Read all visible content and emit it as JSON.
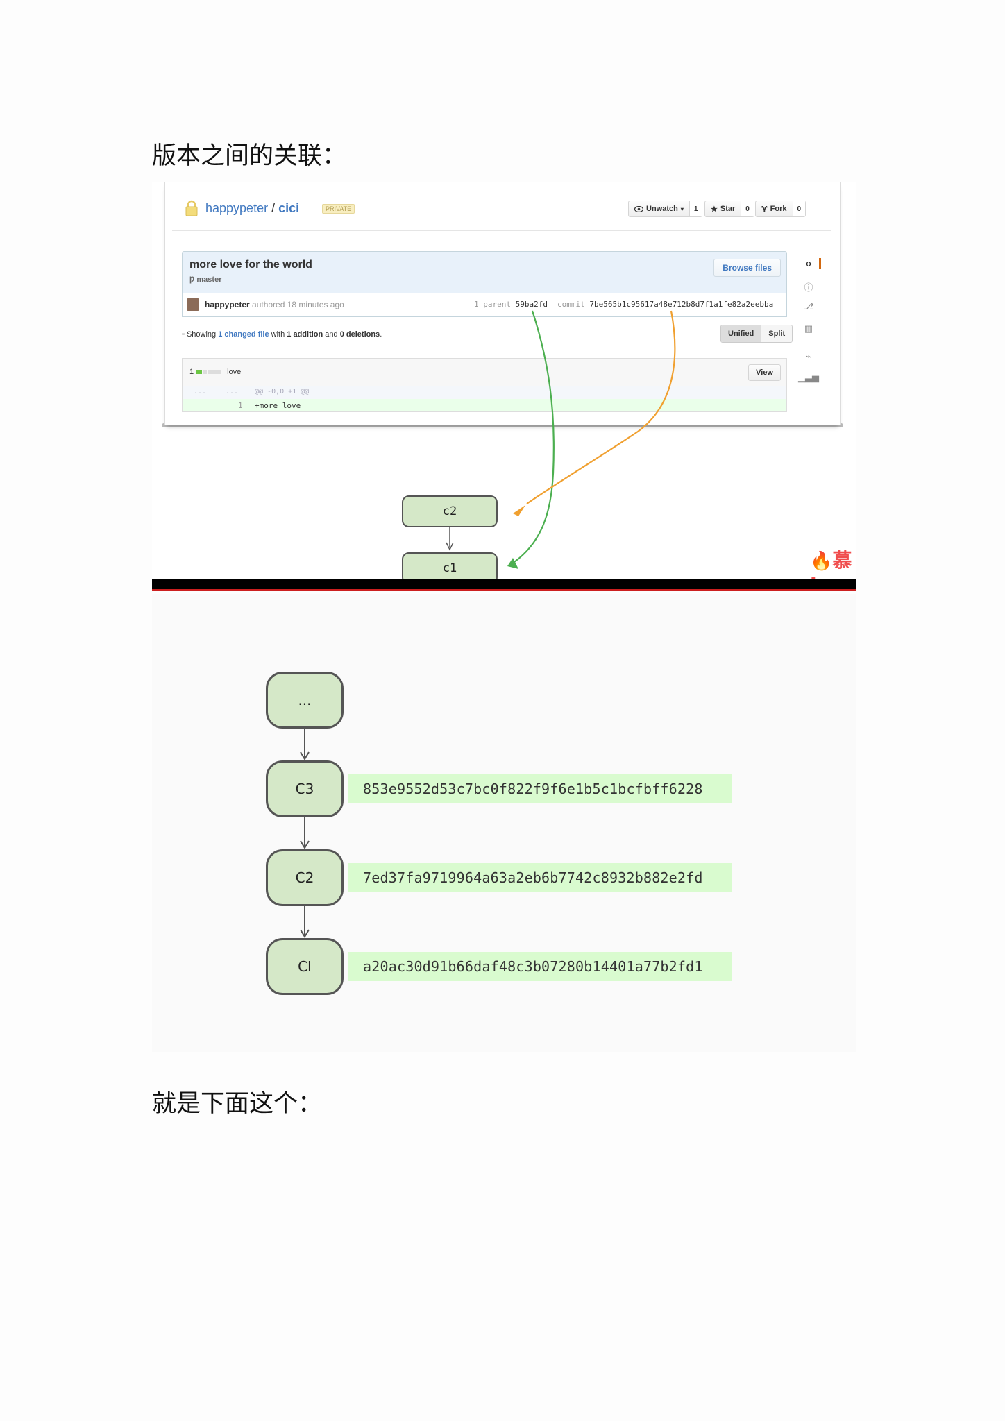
{
  "headings": {
    "first": "版本之间的关联：",
    "second": "就是下面这个："
  },
  "github": {
    "owner": "happypeter",
    "separator": "/",
    "repo": "cici",
    "private_badge": "PRIVATE",
    "unwatch_label": "Unwatch",
    "unwatch_count": "1",
    "star_label": "Star",
    "star_count": "0",
    "fork_label": "Fork",
    "fork_count": "0",
    "commit_title": "more love for the world",
    "branch": "master",
    "browse_files": "Browse files",
    "author": "happypeter",
    "authored_text": "authored 18 minutes ago",
    "parent_prefix": "1 parent",
    "parent_sha": "59ba2fd",
    "commit_prefix": "commit",
    "commit_sha": "7be565b1c95617a48e712b8d7f1a1fe82a2eebba",
    "showing": {
      "prefix": "Showing",
      "changed": "1 changed file",
      "with": "with",
      "additions": "1 addition",
      "and": "and",
      "deletions": "0 deletions",
      "end": "."
    },
    "unified_label": "Unified",
    "split_label": "Split",
    "file_count": "1",
    "file_name": "love",
    "view_label": "View",
    "hunk_left": "...",
    "hunk_right": "...",
    "hunk_header": "@@ -0,0 +1 @@",
    "line_number": "1",
    "added_line": "+more love"
  },
  "video_diagram": {
    "nodes": [
      "c2",
      "c1"
    ],
    "brand_text": "慕i",
    "arrow_colors": {
      "green": "#4caf50",
      "orange": "#f0a030"
    }
  },
  "commit_diagram": {
    "top_node": "...",
    "commits": [
      {
        "label": "C3",
        "hash": "853e9552d53c7bc0f822f9f6e1b5c1bcfbff6228"
      },
      {
        "label": "C2",
        "hash": "7ed37fa9719964a63a2eb6b7742c8932b882e2fd"
      },
      {
        "label": "CI",
        "hash": "a20ac30d91b66daf48c3b07280b14401a77b2fd1"
      }
    ],
    "node_color": "#d5e8c8",
    "hash_bg_color": "#d9fbcf"
  }
}
